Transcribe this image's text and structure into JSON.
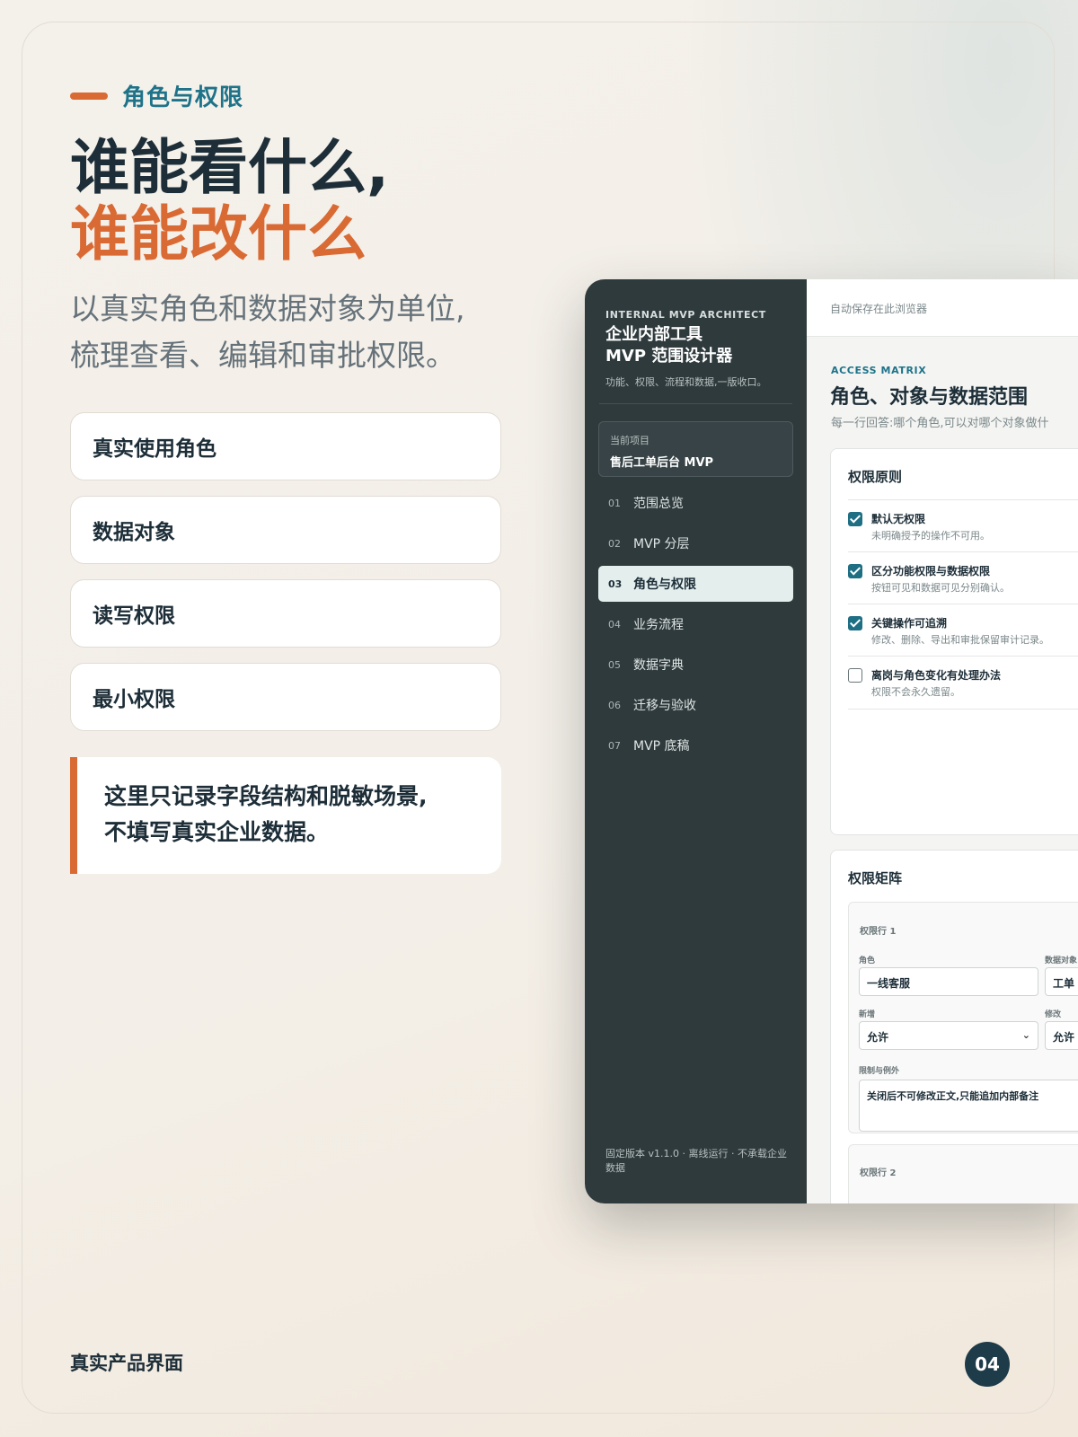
{
  "slide": {
    "kicker": "角色与权限",
    "title_line1": "谁能看什么,",
    "title_line2": "谁能改什么",
    "lead_line1": "以真实角色和数据对象为单位,",
    "lead_line2": "梳理查看、编辑和审批权限。",
    "cards": [
      "真实使用角色",
      "数据对象",
      "读写权限",
      "最小权限"
    ],
    "note_line1": "这里只记录字段结构和脱敏场景,",
    "note_line2": "不填写真实企业数据。",
    "footer_label": "真实产品界面",
    "page_number": "04"
  },
  "app": {
    "sidebar": {
      "eyebrow": "INTERNAL MVP ARCHITECT",
      "title_line1": "企业内部工具",
      "title_line2": "MVP 范围设计器",
      "subtitle": "功能、权限、流程和数据,一版收口。",
      "project_label": "当前项目",
      "project_name": "售后工单后台 MVP",
      "nav": [
        {
          "num": "01",
          "label": "范围总览"
        },
        {
          "num": "02",
          "label": "MVP 分层"
        },
        {
          "num": "03",
          "label": "角色与权限"
        },
        {
          "num": "04",
          "label": "业务流程"
        },
        {
          "num": "05",
          "label": "数据字典"
        },
        {
          "num": "06",
          "label": "迁移与验收"
        },
        {
          "num": "07",
          "label": "MVP 底稿"
        }
      ],
      "active_index": 2,
      "footer": "固定版本 v1.1.0 · 离线运行 · 不承载企业数据"
    },
    "main": {
      "autosave": "自动保存在此浏览器",
      "eyebrow": "ACCESS MATRIX",
      "title": "角色、对象与数据范围",
      "description": "每一行回答:哪个角色,可以对哪个对象做什",
      "principles_heading": "权限原则",
      "principles": [
        {
          "title": "默认无权限",
          "desc": "未明确授予的操作不可用。",
          "checked": true
        },
        {
          "title": "区分功能权限与数据权限",
          "desc": "按钮可见和数据可见分别确认。",
          "checked": true
        },
        {
          "title": "关键操作可追溯",
          "desc": "修改、删除、导出和审批保留审计记录。",
          "checked": true
        },
        {
          "title": "离岗与角色变化有处理办法",
          "desc": "权限不会永久遗留。",
          "checked": false
        }
      ],
      "matrix_heading": "权限矩阵",
      "row1": {
        "title": "权限行 1",
        "role_label": "角色",
        "role_value": "一线客服",
        "object_label": "数据对象",
        "object_value": "工单",
        "create_label": "新增",
        "create_value": "允许",
        "modify_label": "修改",
        "modify_value": "允许",
        "limits_label": "限制与例外",
        "limits_value": "关闭后不可修改正文,只能追加内部备注"
      },
      "row2_title": "权限行 2"
    }
  },
  "colors": {
    "accent": "#d96a34",
    "teal": "#1e7389",
    "navy": "#1d2e38",
    "sidebar": "#2f3a3d",
    "checkbox": "#1e6f84"
  }
}
